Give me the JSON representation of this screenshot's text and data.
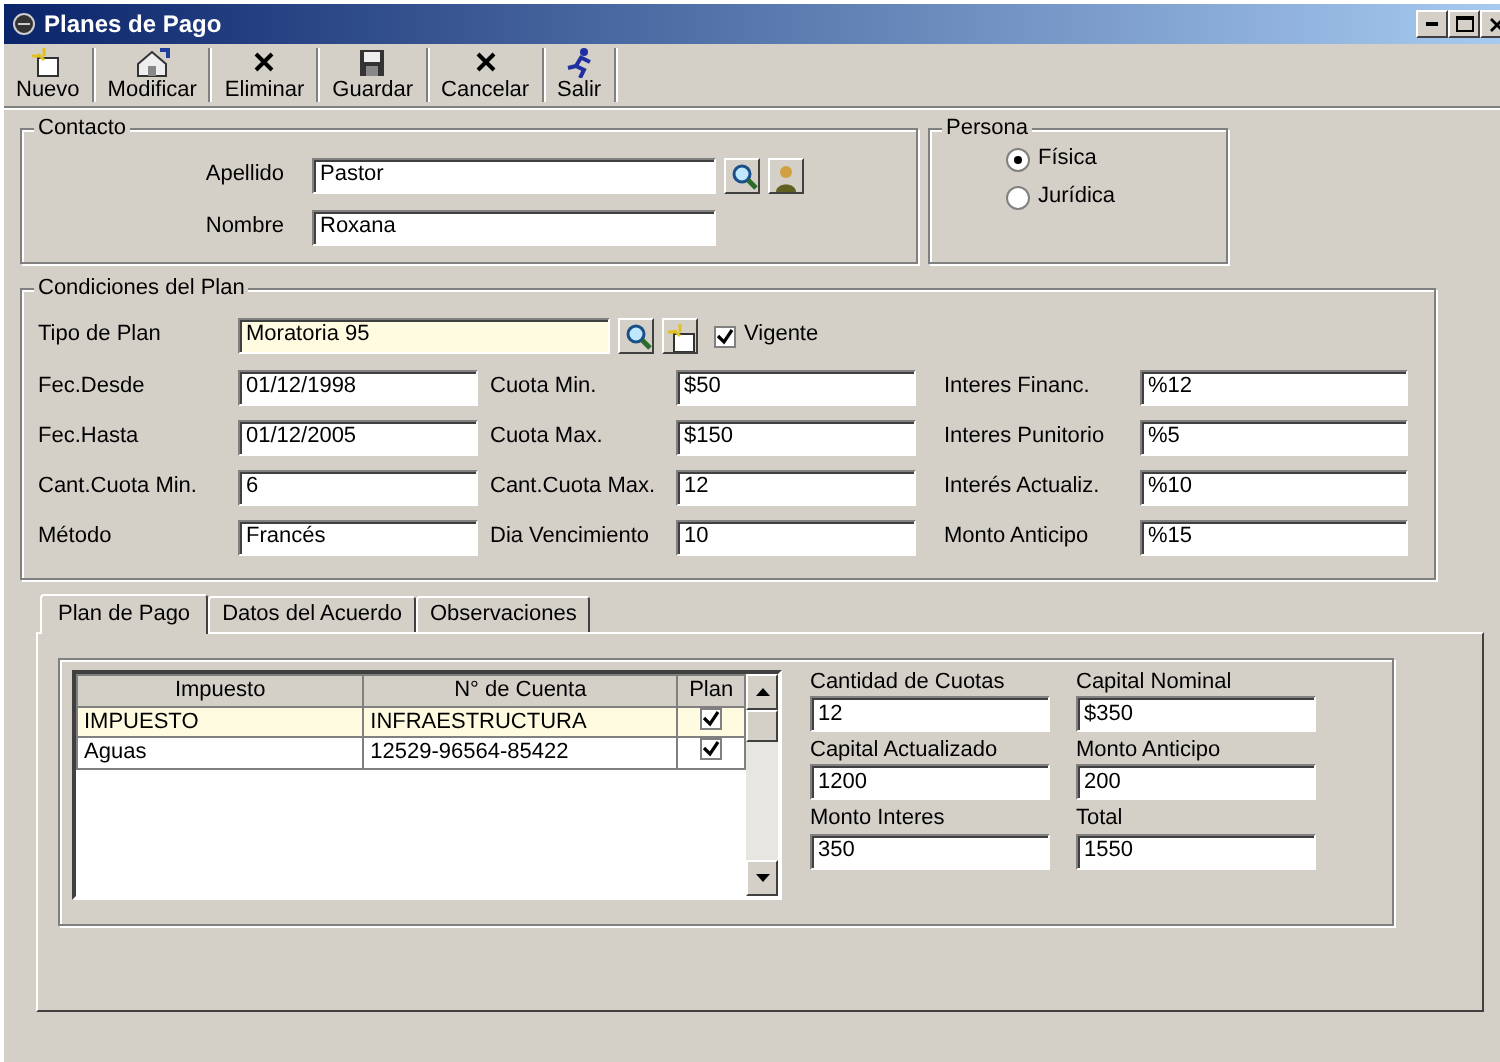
{
  "window": {
    "title": "Planes de Pago"
  },
  "toolbar": [
    {
      "label": "Nuevo",
      "kind": "new"
    },
    {
      "label": "Modificar",
      "kind": "edit"
    },
    {
      "label": "Eliminar",
      "kind": "delete"
    },
    {
      "label": "Guardar",
      "kind": "save"
    },
    {
      "label": "Cancelar",
      "kind": "cancel"
    },
    {
      "label": "Salir",
      "kind": "exit"
    }
  ],
  "contacto": {
    "title": "Contacto",
    "fields": [
      {
        "label": "Apellido",
        "value": "Pastor"
      },
      {
        "label": "Nombre",
        "value": "Roxana"
      }
    ]
  },
  "persona": {
    "title": "Persona",
    "options": [
      {
        "label": "Física",
        "selected": true
      },
      {
        "label": "Jurídica",
        "selected": false
      }
    ]
  },
  "condiciones": {
    "title": "Condiciones del Plan",
    "tipo_de_plan": {
      "label": "Tipo de Plan",
      "value": "Moratoria 95"
    },
    "vigente": {
      "label": "Vigente",
      "checked": true
    },
    "columns": [
      [
        {
          "label": "Fec.Desde",
          "value": "01/12/1998"
        },
        {
          "label": "Fec.Hasta",
          "value": "01/12/2005"
        },
        {
          "label": "Cant.Cuota Min.",
          "value": "6"
        },
        {
          "label": "Método",
          "value": "Francés"
        }
      ],
      [
        {
          "label": "Cuota Min.",
          "value": "$50"
        },
        {
          "label": "Cuota Max.",
          "value": "$150"
        },
        {
          "label": "Cant.Cuota Max.",
          "value": "12"
        },
        {
          "label": "Dia Vencimiento",
          "value": "10"
        }
      ],
      [
        {
          "label": "Interes Financ.",
          "value": "%12"
        },
        {
          "label": "Interes Punitorio",
          "value": "%5"
        },
        {
          "label": "Interés Actualiz.",
          "value": "%10"
        },
        {
          "label": "Monto Anticipo",
          "value": "%15"
        }
      ]
    ]
  },
  "tabs": [
    {
      "label": "Plan de Pago",
      "selected": true
    },
    {
      "label": "Datos del Acuerdo",
      "selected": false
    },
    {
      "label": "Observaciones",
      "selected": false
    }
  ],
  "table": {
    "columns": [
      "Impuesto",
      "N° de Cuenta",
      "Plan"
    ],
    "rows": [
      {
        "impuesto": "IMPUESTO",
        "cuenta": "INFRAESTRUCTURA",
        "plan": true,
        "selected": true
      },
      {
        "impuesto": "Aguas",
        "cuenta": "12529-96564-85422",
        "plan": true,
        "selected": false
      }
    ]
  },
  "totals": [
    {
      "label": "Cantidad de Cuotas",
      "value": "12"
    },
    {
      "label": "Capital Nominal",
      "value": "$350"
    },
    {
      "label": "Capital Actualizado",
      "value": "1200"
    },
    {
      "label": "Monto Anticipo",
      "value": "200"
    },
    {
      "label": "Monto Interes",
      "value": "350"
    },
    {
      "label": "Total",
      "value": "1550"
    }
  ]
}
